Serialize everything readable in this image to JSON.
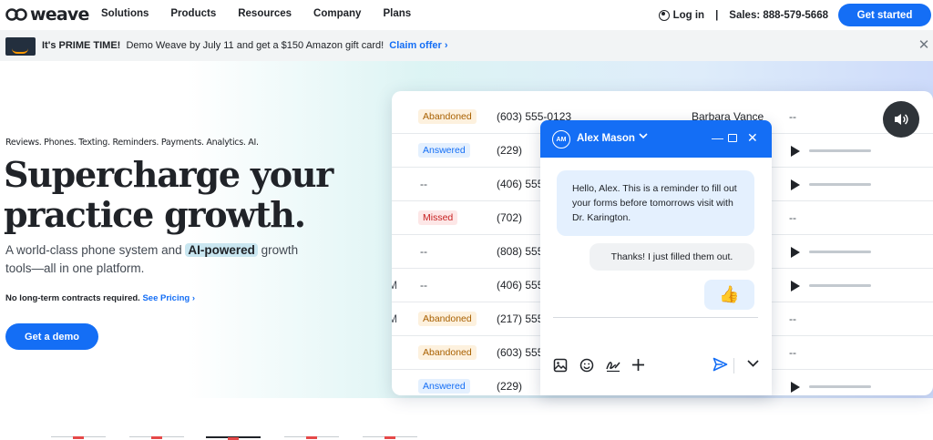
{
  "nav": {
    "brand": "weave",
    "links": [
      "Solutions",
      "Products",
      "Resources",
      "Company",
      "Plans"
    ],
    "login": "Log in",
    "separator": "|",
    "sales": "Sales: 888-579-5668",
    "cta": "Get started"
  },
  "promo": {
    "bold": "It's PRIME TIME!",
    "text": "Demo Weave by July 11 and get a $150 Amazon gift card!",
    "link": "Claim offer",
    "link_arrow": "›",
    "close": "✕"
  },
  "hero": {
    "tagline": "Reviews. Phones. Texting. Reminders. Payments. Analytics. AI.",
    "headline_line1": "Supercharge your",
    "headline_line2": "practice growth.",
    "subhead_before": "A world-class phone system and ",
    "subhead_chip": "AI-powered",
    "subhead_after": " growth tools—all in one platform.",
    "contracts": "No long-term contracts required.",
    "pricing_link": "See Pricing",
    "pricing_arrow": "›",
    "demo_button": "Get a demo"
  },
  "call_log": {
    "rows": [
      {
        "time": "",
        "status": "Abandoned",
        "kind": "abandoned",
        "phone": "(603) 555-0123",
        "name": "Barbara Vance",
        "dash": "--",
        "play": false
      },
      {
        "time": "",
        "status": "Answered",
        "kind": "answered",
        "phone": "(229)",
        "name": "",
        "dash": "",
        "play": true
      },
      {
        "time": "",
        "status": "--",
        "kind": "none",
        "phone": "(406) 555",
        "name": "",
        "dash": "",
        "play": true
      },
      {
        "time": "",
        "status": "Missed",
        "kind": "missed",
        "phone": "(702)",
        "name": "",
        "dash": "--",
        "play": false
      },
      {
        "time": "",
        "status": "--",
        "kind": "none",
        "phone": "(808) 555",
        "name": "",
        "dash": "",
        "play": true
      },
      {
        "time": "M",
        "status": "--",
        "kind": "none",
        "phone": "(406) 555",
        "name": "",
        "dash": "",
        "play": true
      },
      {
        "time": "M",
        "status": "Abandoned",
        "kind": "abandoned",
        "phone": "(217) 555",
        "name": "",
        "dash": "--",
        "play": false
      },
      {
        "time": "",
        "status": "Abandoned",
        "kind": "abandoned",
        "phone": "(603) 555",
        "name": "",
        "dash": "--",
        "play": false
      },
      {
        "time": "",
        "status": "Answered",
        "kind": "answered",
        "phone": "(229)",
        "name": "",
        "dash": "",
        "play": true
      }
    ]
  },
  "chat": {
    "initials": "AM",
    "contact": "Alex Mason",
    "chevron": "⌄",
    "minimize": "—",
    "close": "✕",
    "incoming": "Hello, Alex. This is a reminder to fill out your forms before tomorrows visit with Dr. Karington.",
    "outgoing": "Thanks! I just filled them out.",
    "reaction": "👍"
  },
  "icons": {
    "image": "image-icon",
    "emoji": "emoji-icon",
    "signature": "signature-icon",
    "add": "plus-icon",
    "send": "send-icon",
    "more": "chevron-down-icon",
    "audio": "speaker-icon"
  },
  "colors": {
    "brand_blue": "#146ef5",
    "abandoned": "#a86000",
    "missed": "#c61e1e",
    "dark": "#202328"
  }
}
